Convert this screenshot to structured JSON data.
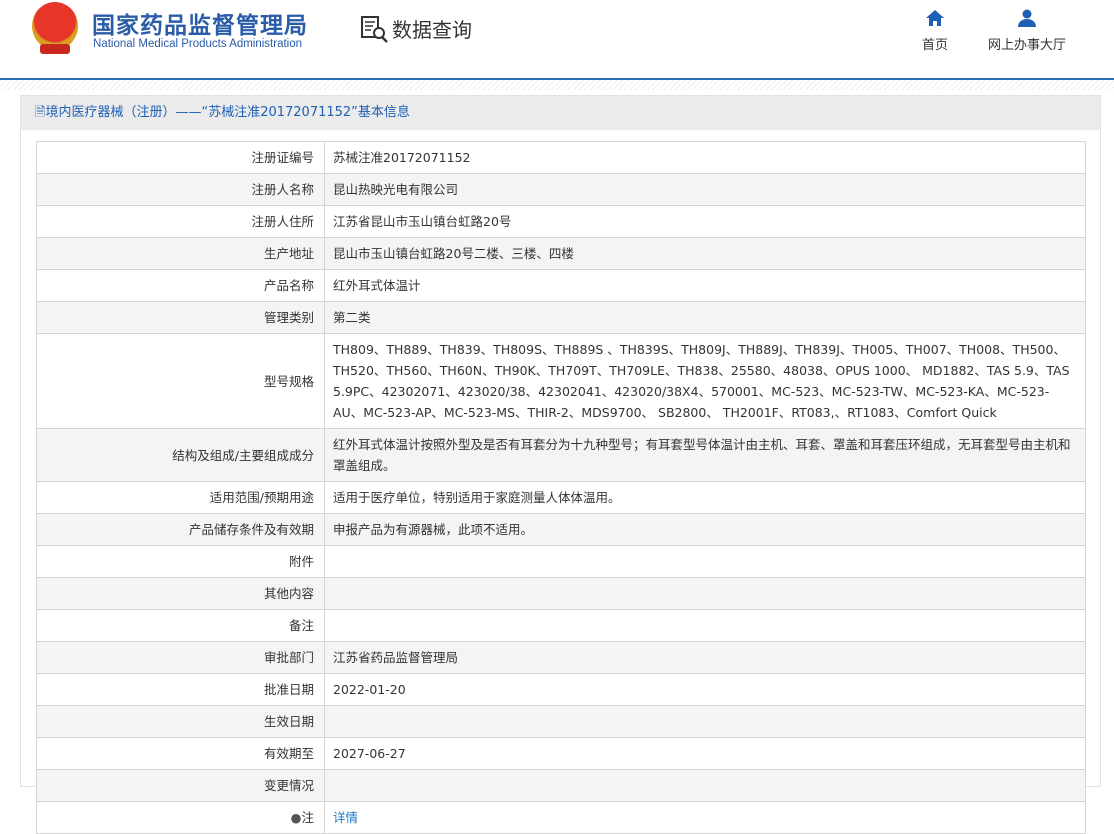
{
  "header": {
    "logo_cn": "国家药品监督管理局",
    "logo_en": "National Medical Products Administration",
    "section": "数据查询",
    "nav": [
      {
        "label": "首页",
        "icon": "home-icon"
      },
      {
        "label": "网上办事大厅",
        "icon": "user-icon"
      }
    ]
  },
  "panel": {
    "title": "境内医疗器械（注册）——“苏械注准20172071152”基本信息"
  },
  "rows": [
    {
      "label": "注册证编号",
      "value": "苏械注准20172071152"
    },
    {
      "label": "注册人名称",
      "value": "昆山热映光电有限公司"
    },
    {
      "label": "注册人住所",
      "value": "江苏省昆山市玉山镇台虹路20号"
    },
    {
      "label": "生产地址",
      "value": "昆山市玉山镇台虹路20号二楼、三楼、四楼"
    },
    {
      "label": "产品名称",
      "value": "红外耳式体温计"
    },
    {
      "label": "管理类别",
      "value": "第二类"
    },
    {
      "label": "型号规格",
      "value": "TH809、TH889、TH839、TH809S、TH889S 、TH839S、TH809J、TH889J、TH839J、TH005、TH007、TH008、TH500、TH520、TH560、TH60N、TH90K、TH709T、TH709LE、TH838、25580、48038、OPUS 1000、 MD1882、TAS 5.9、TAS 5.9PC、42302071、423020/38、42302041、423020/38X4、570001、MC-523、MC-523-TW、MC-523-KA、MC-523-AU、MC-523-AP、MC-523-MS、THIR-2、MDS9700、 SB2800、 TH2001F、RT083,、RT1083、Comfort Quick"
    },
    {
      "label": "结构及组成/主要组成成分",
      "value": "红外耳式体温计按照外型及是否有耳套分为十九种型号；有耳套型号体温计由主机、耳套、罩盖和耳套压环组成，无耳套型号由主机和罩盖组成。"
    },
    {
      "label": "适用范围/预期用途",
      "value": "适用于医疗单位，特别适用于家庭测量人体体温用。"
    },
    {
      "label": "产品储存条件及有效期",
      "value": "申报产品为有源器械，此项不适用。"
    },
    {
      "label": "附件",
      "value": ""
    },
    {
      "label": "其他内容",
      "value": ""
    },
    {
      "label": "备注",
      "value": ""
    },
    {
      "label": "审批部门",
      "value": "江苏省药品监督管理局"
    },
    {
      "label": "批准日期",
      "value": "2022-01-20"
    },
    {
      "label": "生效日期",
      "value": ""
    },
    {
      "label": "有效期至",
      "value": "2027-06-27"
    },
    {
      "label": "变更情况",
      "value": ""
    }
  ],
  "note": {
    "label": "注",
    "link": "详情"
  }
}
